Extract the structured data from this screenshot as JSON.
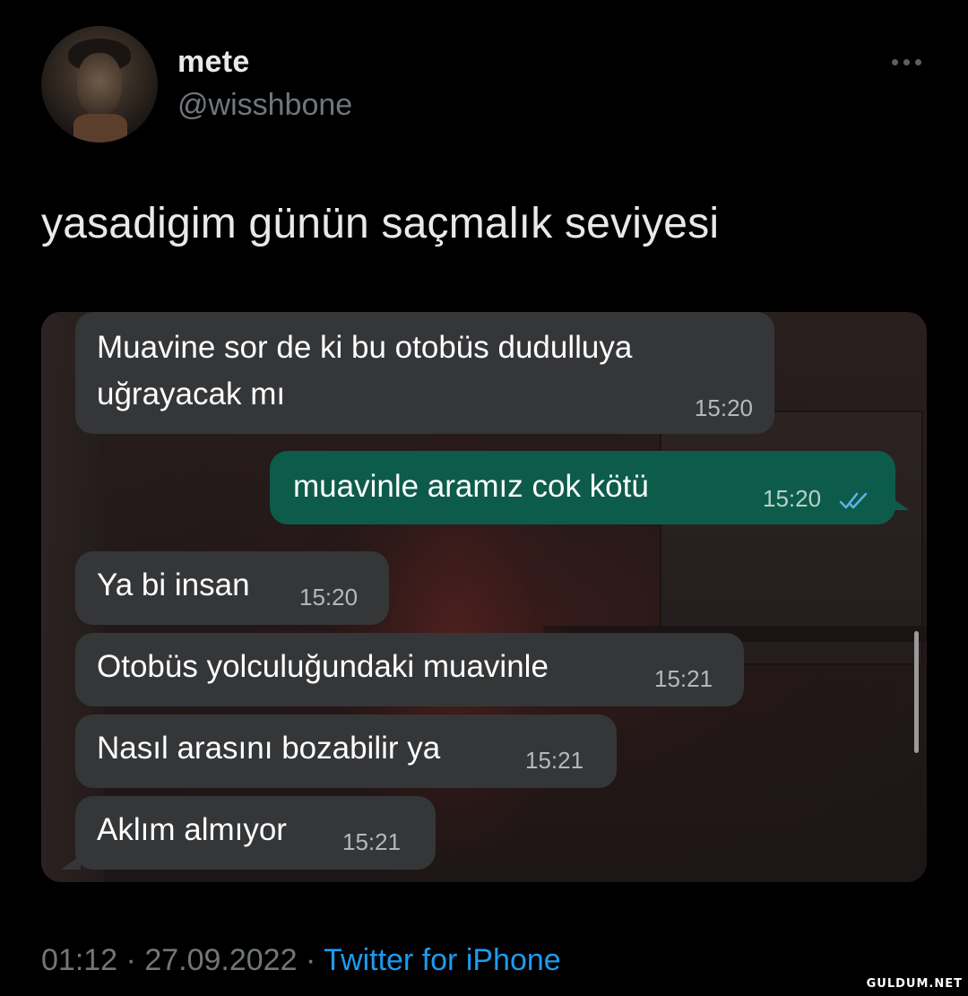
{
  "tweet": {
    "display_name": "mete",
    "handle": "@wisshbone",
    "text": "yasadigim günün saçmalık seviyesi",
    "more_icon": "more-horizontal-icon",
    "time": "01:12",
    "separator": "·",
    "date": "27.09.2022",
    "source": "Twitter for iPhone"
  },
  "chat": {
    "messages": [
      {
        "direction": "incoming",
        "line1": "Muavine sor de ki bu otobüs dudulluya",
        "line2": "uğrayacak mı",
        "time": "15:20"
      },
      {
        "direction": "outgoing",
        "text": "muavinle aramız cok kötü",
        "time": "15:20",
        "status_icon": "double-check-icon"
      },
      {
        "direction": "incoming",
        "text": "Ya bi insan",
        "time": "15:20"
      },
      {
        "direction": "incoming",
        "text": "Otobüs yolculuğundaki muavinle",
        "time": "15:21"
      },
      {
        "direction": "incoming",
        "text": "Nasıl arasını bozabilir ya",
        "time": "15:21"
      },
      {
        "direction": "incoming",
        "text": "Aklım almıyor",
        "time": "15:21"
      }
    ]
  },
  "watermark": "GULDUM.NET",
  "colors": {
    "background": "#000000",
    "incoming_bubble": "#353638",
    "outgoing_bubble": "#0d5c4b",
    "link_blue": "#1d9bf0",
    "muted_gray": "#71767b"
  }
}
